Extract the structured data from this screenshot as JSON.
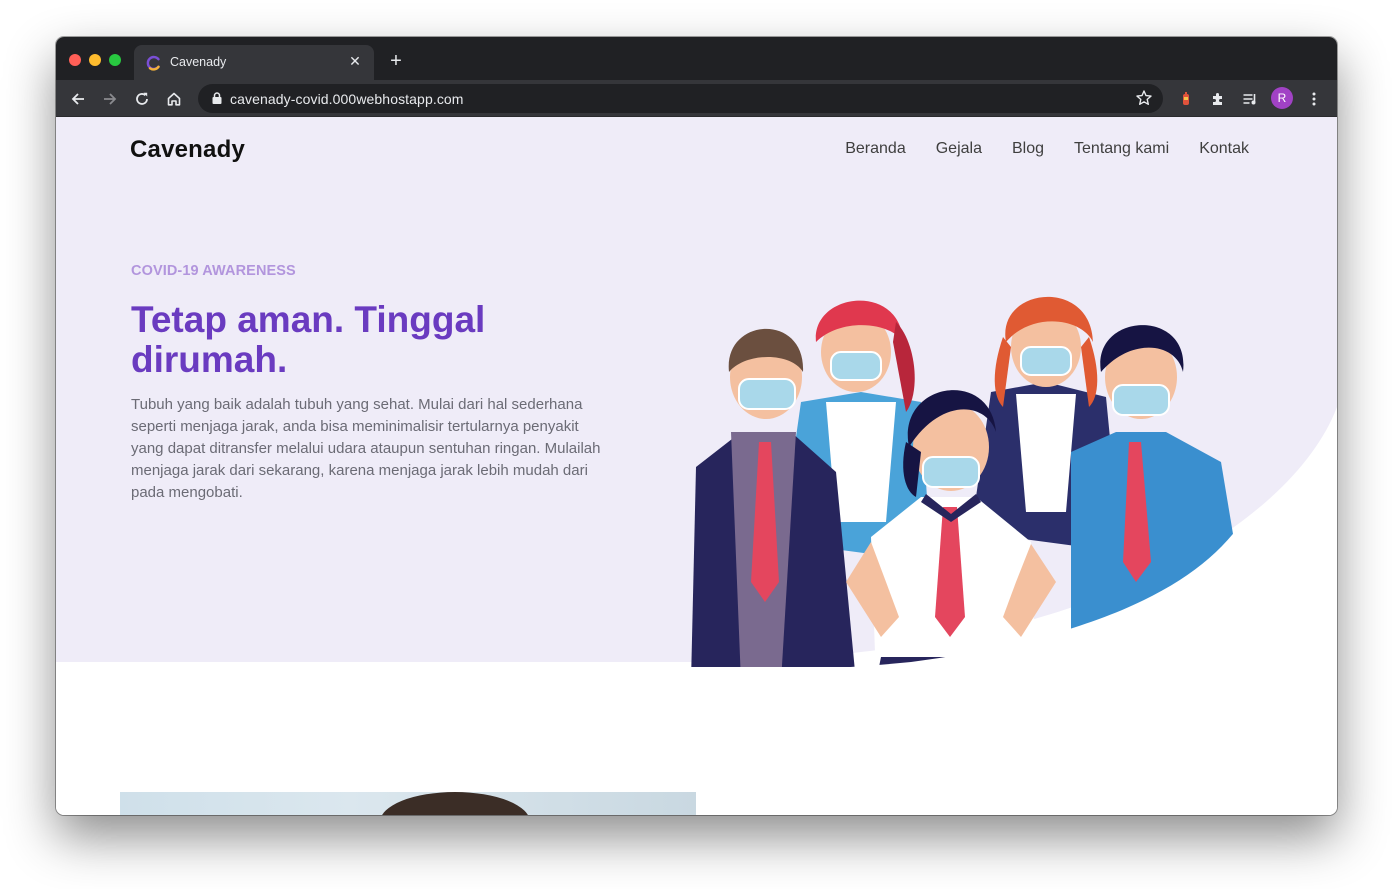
{
  "browser": {
    "tab_title": "Cavenady",
    "url": "cavenady-covid.000webhostapp.com",
    "profile_initial": "R"
  },
  "site": {
    "brand": "Cavenady",
    "nav": [
      "Beranda",
      "Gejala",
      "Blog",
      "Tentang kami",
      "Kontak"
    ],
    "eyebrow": "COVID-19 AWARENESS",
    "headline": "Tetap aman. Tinggal dirumah.",
    "description": "Tubuh yang baik adalah tubuh yang sehat. Mulai dari hal sederhana seperti menjaga jarak, anda bisa meminimalisir tertularnya penyakit yang dapat ditransfer melalui udara ataupun sentuhan ringan. Mulailah menjaga jarak dari sekarang, karena menjaga jarak lebih mudah dari pada mengobati."
  },
  "colors": {
    "hero_background": "#efecf8",
    "accent_purple": "#6a3bc0",
    "eyebrow_lavender": "#b295dd"
  }
}
